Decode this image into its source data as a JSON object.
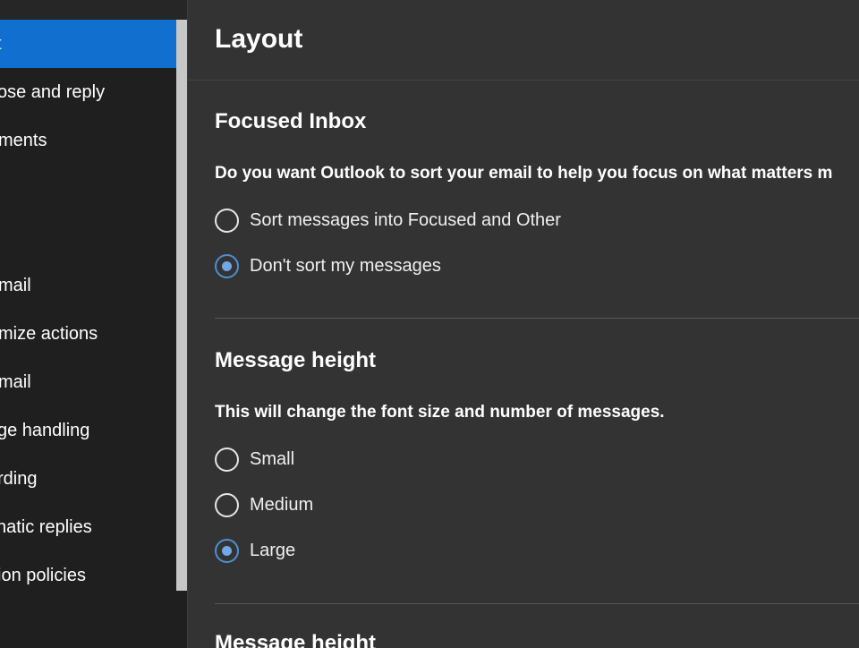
{
  "sidebar": {
    "items": [
      {
        "label": "t",
        "selected": true
      },
      {
        "label": "ose and reply"
      },
      {
        "label": "ments"
      },
      {
        "label": "mail"
      },
      {
        "label": "mize actions"
      },
      {
        "label": "mail"
      },
      {
        "label": "ge handling"
      },
      {
        "label": "rding"
      },
      {
        "label": "natic replies"
      },
      {
        "label": "ion policies"
      }
    ]
  },
  "main": {
    "title": "Layout",
    "focused_inbox": {
      "title": "Focused Inbox",
      "description": "Do you want Outlook to sort your email to help you focus on what matters m",
      "options": [
        {
          "label": "Sort messages into Focused and Other",
          "checked": false
        },
        {
          "label": "Don't sort my messages",
          "checked": true
        }
      ]
    },
    "message_height": {
      "title": "Message height",
      "description": "This will change the font size and number of messages.",
      "options": [
        {
          "label": "Small",
          "checked": false
        },
        {
          "label": "Medium",
          "checked": false
        },
        {
          "label": "Large",
          "checked": true
        }
      ]
    },
    "next_section": {
      "title": "Message height"
    }
  },
  "colors": {
    "accent": "#1170cf",
    "radio_dot": "#70a8e8",
    "background": "#333333",
    "sidebar": "#1f1f1f"
  }
}
